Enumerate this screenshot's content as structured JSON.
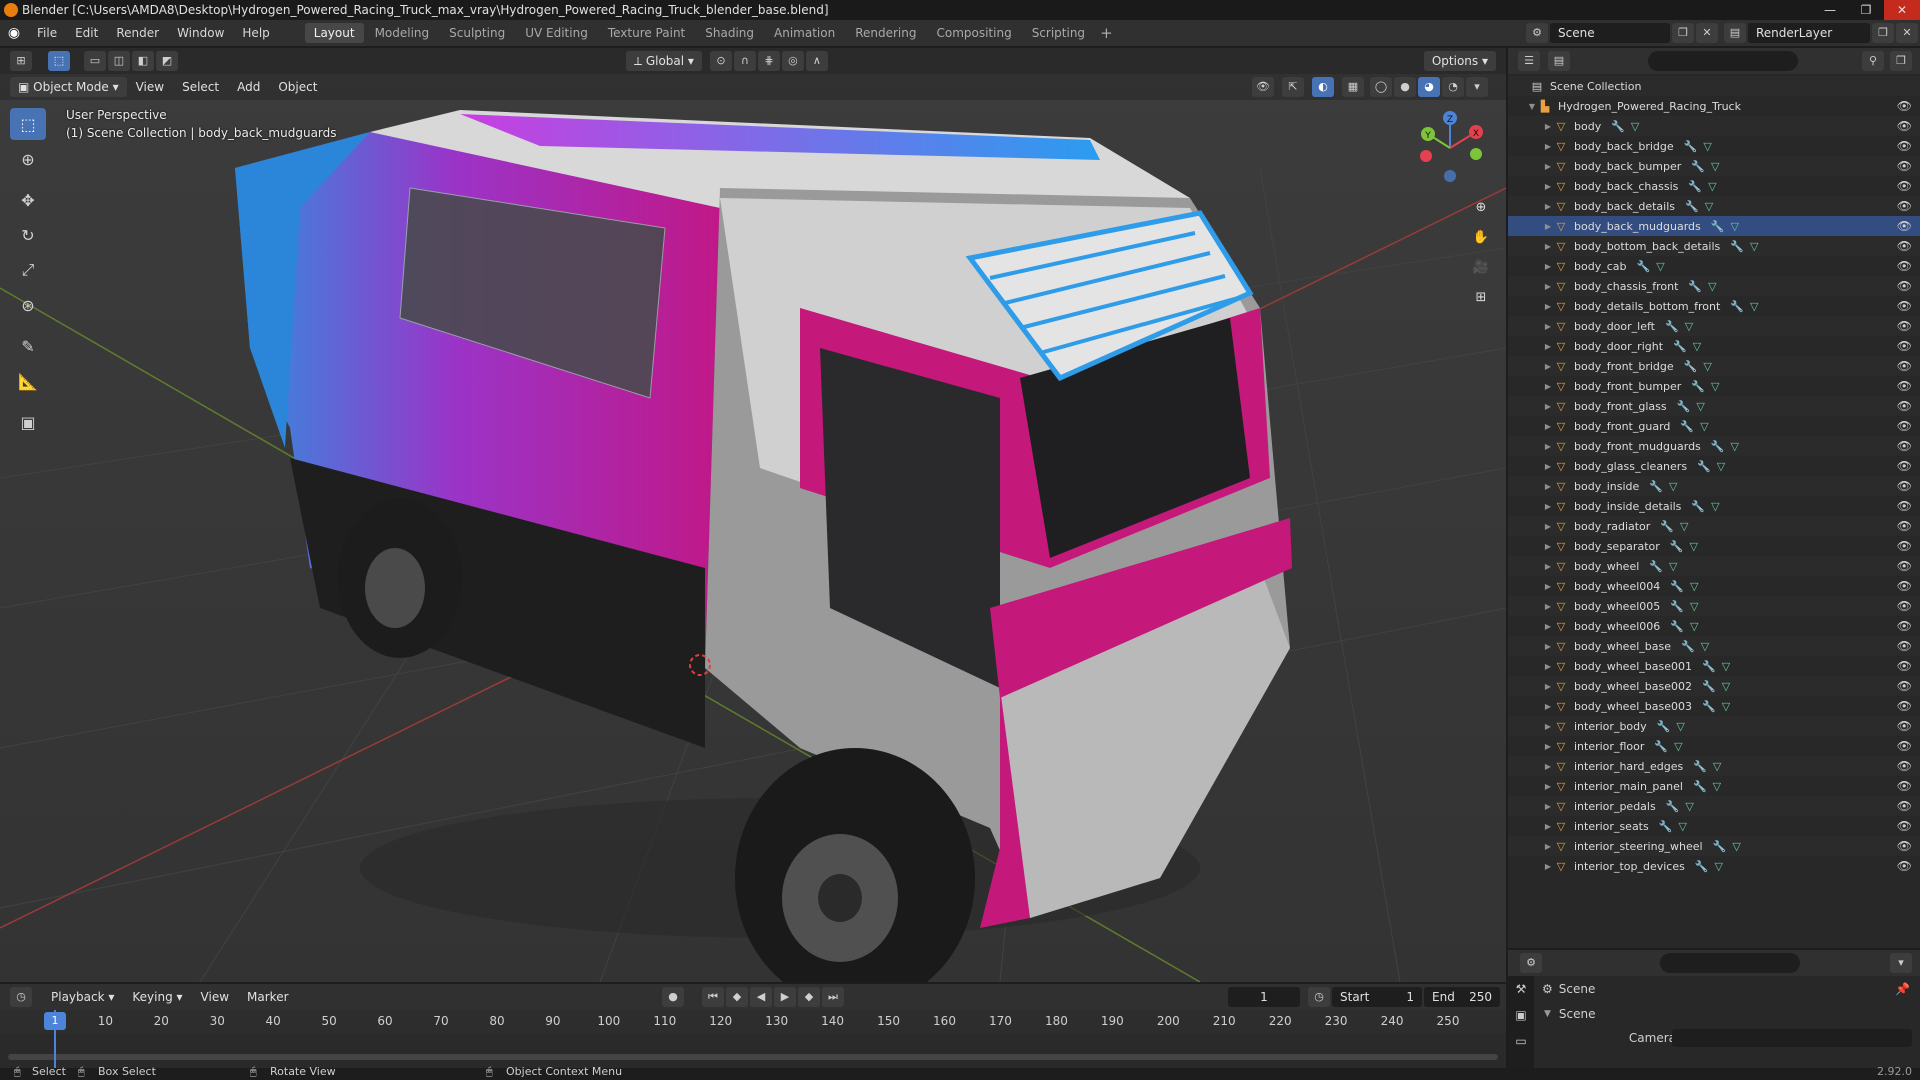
{
  "window": {
    "title": "Blender [C:\\Users\\AMDA8\\Desktop\\Hydrogen_Powered_Racing_Truck_max_vray\\Hydrogen_Powered_Racing_Truck_blender_base.blend]",
    "minimize": "—",
    "maximize": "❐",
    "close": "✕"
  },
  "menu": [
    "File",
    "Edit",
    "Render",
    "Window",
    "Help"
  ],
  "workspaces": [
    {
      "label": "Layout",
      "active": true
    },
    {
      "label": "Modeling"
    },
    {
      "label": "Sculpting"
    },
    {
      "label": "UV Editing"
    },
    {
      "label": "Texture Paint"
    },
    {
      "label": "Shading"
    },
    {
      "label": "Animation"
    },
    {
      "label": "Rendering"
    },
    {
      "label": "Compositing"
    },
    {
      "label": "Scripting"
    }
  ],
  "workspace_add": "+",
  "scene": {
    "name": "Scene",
    "view_layer": "RenderLayer"
  },
  "viewport": {
    "mode": "Object Mode",
    "menus": [
      "View",
      "Select",
      "Add",
      "Object"
    ],
    "orientation": "Global",
    "options": "Options",
    "overlay_line1": "User Perspective",
    "overlay_line2": "(1) Scene Collection | body_back_mudguards",
    "gizmo_labels": {
      "z": "Z",
      "y": "Y",
      "x": "X"
    }
  },
  "outliner": {
    "root": "Scene Collection",
    "collection": "Hydrogen_Powered_Racing_Truck",
    "selected": "body_back_mudguards",
    "objects": [
      "body",
      "body_back_bridge",
      "body_back_bumper",
      "body_back_chassis",
      "body_back_details",
      "body_back_mudguards",
      "body_bottom_back_details",
      "body_cab",
      "body_chassis_front",
      "body_details_bottom_front",
      "body_door_left",
      "body_door_right",
      "body_front_bridge",
      "body_front_bumper",
      "body_front_glass",
      "body_front_guard",
      "body_front_mudguards",
      "body_glass_cleaners",
      "body_inside",
      "body_inside_details",
      "body_radiator",
      "body_separator",
      "body_wheel",
      "body_wheel004",
      "body_wheel005",
      "body_wheel006",
      "body_wheel_base",
      "body_wheel_base001",
      "body_wheel_base002",
      "body_wheel_base003",
      "interior_body",
      "interior_floor",
      "interior_hard_edges",
      "interior_main_panel",
      "interior_pedals",
      "interior_seats",
      "interior_steering_wheel",
      "interior_top_devices"
    ]
  },
  "properties": {
    "context": "Scene",
    "panel": "Scene",
    "camera_label": "Camera"
  },
  "timeline": {
    "menus": [
      "Playback",
      "Keying",
      "View",
      "Marker"
    ],
    "current_frame": "1",
    "start_label": "Start",
    "start": "1",
    "end_label": "End",
    "end": "250",
    "ticks": [
      1,
      10,
      20,
      30,
      40,
      50,
      60,
      70,
      80,
      90,
      100,
      110,
      120,
      130,
      140,
      150,
      160,
      170,
      180,
      190,
      200,
      210,
      220,
      230,
      240,
      250
    ]
  },
  "statusbar": {
    "select": "Select",
    "box_select": "Box Select",
    "rotate": "Rotate View",
    "context_menu": "Object Context Menu",
    "version": "2.92.0"
  },
  "colors": {
    "accent": "#4772b3",
    "object_icon": "#e8a040",
    "mesh_icon": "#63c8a8",
    "axis_x": "#e5404e",
    "axis_y": "#7ec43b",
    "axis_z": "#4b84d8"
  }
}
